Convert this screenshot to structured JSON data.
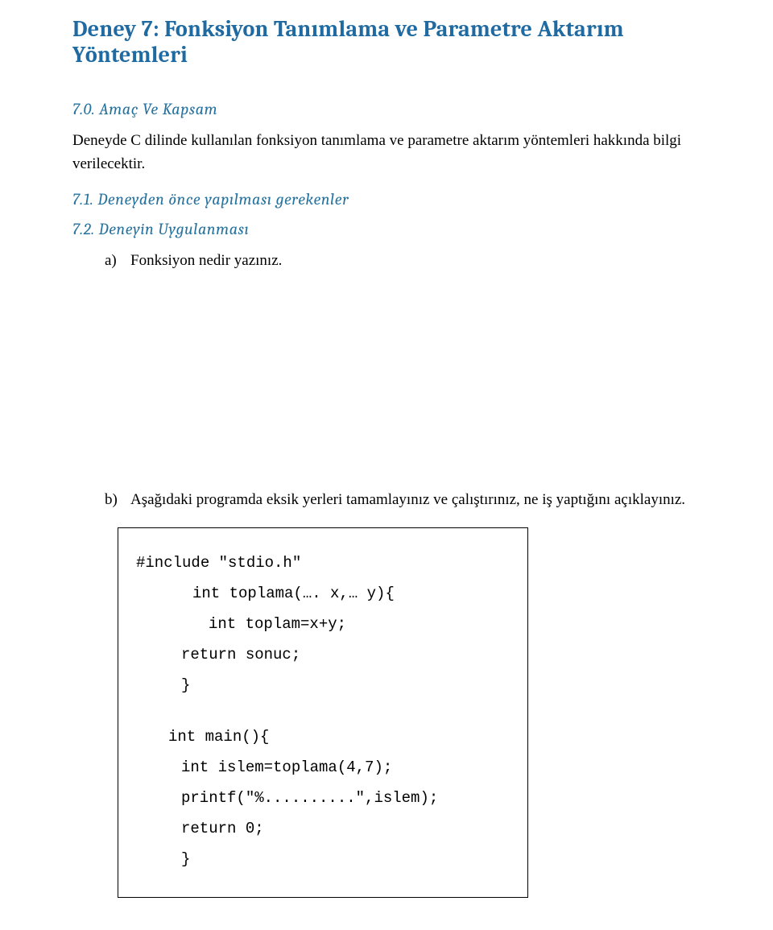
{
  "title": "Deney 7:  Fonksiyon Tanımlama ve Parametre Aktarım Yöntemleri",
  "sections": {
    "s0": {
      "heading": "7.0. Amaç Ve Kapsam",
      "body": "Deneyde C dilinde kullanılan fonksiyon tanımlama ve parametre aktarım yöntemleri hakkında bilgi verilecektir."
    },
    "s1": {
      "heading": "7.1. Deneyden önce yapılması gerekenler"
    },
    "s2": {
      "heading": "7.2. Deneyin Uygulanması",
      "items": {
        "a": {
          "marker": "a)",
          "text": "Fonksiyon nedir yazınız."
        },
        "b": {
          "marker": "b)",
          "text": "Aşağıdaki programda eksik yerleri tamamlayınız ve çalıştırınız, ne iş yaptığını açıklayınız."
        }
      }
    }
  },
  "code": {
    "l1": "#include \"stdio.h\"",
    "l2": "int toplama(…. x,… y){",
    "l3": "int toplam=x+y;",
    "l4": "return sonuc;",
    "l5": "}",
    "l6": "int main(){",
    "l7": "int islem=toplama(4,7);",
    "l8": "printf(\"%..........\",islem);",
    "l9": "return 0;",
    "l10": "}"
  }
}
